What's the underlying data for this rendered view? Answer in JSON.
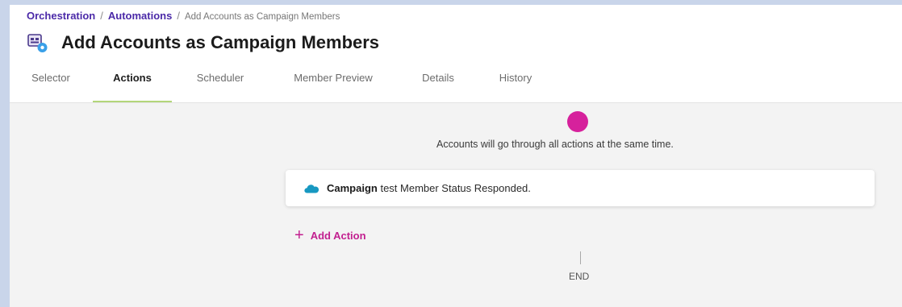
{
  "breadcrumb": {
    "items": [
      "Orchestration",
      "Automations"
    ],
    "separator": "/",
    "current": "Add Accounts as Campaign Members"
  },
  "page": {
    "title": "Add Accounts as Campaign Members",
    "icon": "automation-icon"
  },
  "tabs": [
    {
      "label": "Selector",
      "active": false
    },
    {
      "label": "Actions",
      "active": true
    },
    {
      "label": "Scheduler",
      "active": false
    },
    {
      "label": "Member Preview",
      "active": false
    },
    {
      "label": "Details",
      "active": false
    },
    {
      "label": "History",
      "active": false
    }
  ],
  "flow": {
    "note": "Accounts will go through all actions at the same time.",
    "action": {
      "icon": "salesforce-cloud-icon",
      "strong": "Campaign",
      "rest": " test Member Status Responded."
    },
    "add_action_icon": "+",
    "add_action_label": "Add Action",
    "end_label": "END"
  },
  "colors": {
    "brand_purple": "#4b2aa8",
    "accent_magenta": "#d6219c",
    "active_tab_underline": "#b3d67a",
    "salesforce_blue": "#1798c1"
  }
}
